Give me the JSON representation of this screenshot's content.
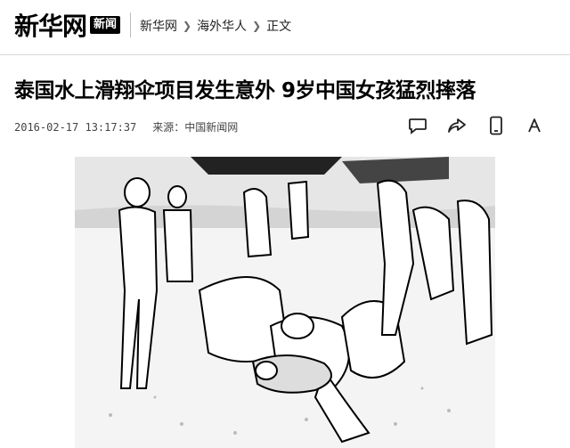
{
  "header": {
    "logo_text": "新华网",
    "logo_badge": "新闻",
    "breadcrumbs": [
      "新华网",
      "海外华人",
      "正文"
    ]
  },
  "article": {
    "title": "泰国水上滑翔伞项目发生意外 9岁中国女孩猛烈摔落",
    "datetime": "2016-02-17 13:17:37",
    "source": "来源：中国新闻网"
  },
  "actions": {
    "icons": [
      "comment-icon",
      "share-icon",
      "mobile-icon",
      "font-size-icon"
    ]
  },
  "image": {
    "description_icon": "photo"
  }
}
